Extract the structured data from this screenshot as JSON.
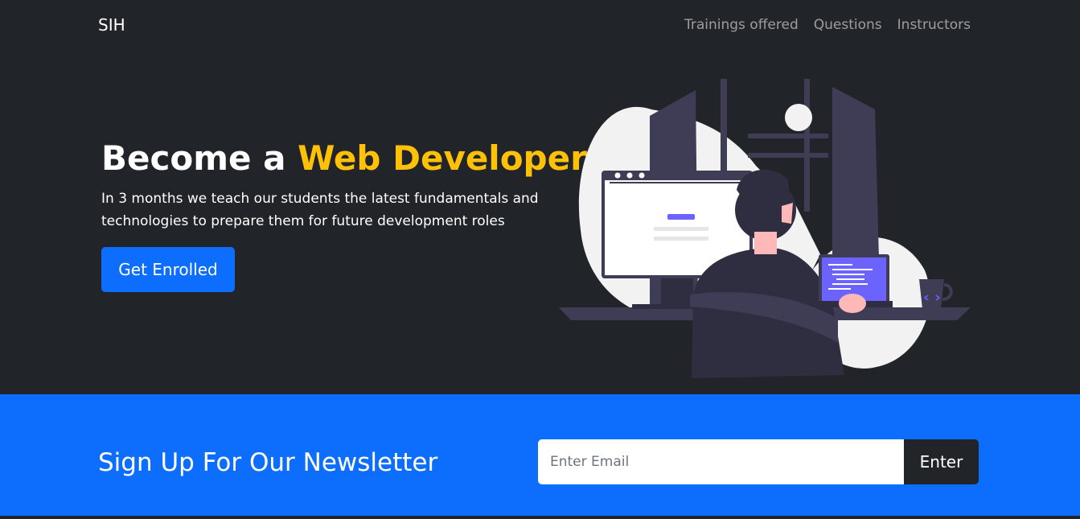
{
  "nav": {
    "brand": "SIH",
    "links": [
      "Trainings offered",
      "Questions",
      "Instructors"
    ]
  },
  "hero": {
    "title_prefix": "Become a ",
    "title_highlight": "Web Developer",
    "description": "In 3 months we teach our students the latest fundamentals and technologies to prepare them for future development roles",
    "button_label": "Get Enrolled",
    "illustration": "developer-at-desk-illustration"
  },
  "newsletter": {
    "title": "Sign Up For Our Newsletter",
    "input_placeholder": "Enter Email",
    "input_value": "",
    "button_label": "Enter"
  },
  "colors": {
    "dark": "#212529",
    "primary": "#0d6efd",
    "accent": "#ffc107",
    "illustration_purple": "#6c63ff",
    "illustration_dark": "#3f3d56"
  }
}
